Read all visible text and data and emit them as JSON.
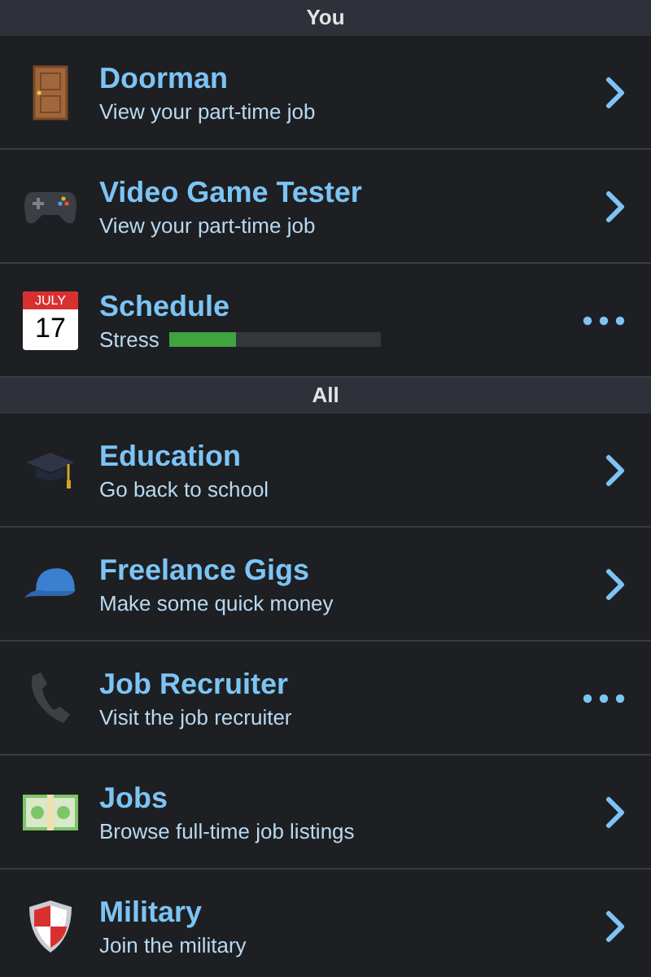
{
  "sections": [
    {
      "title": "You",
      "items": [
        {
          "title": "Doorman",
          "subtitle": "View your part-time job",
          "action": {
            "kind": "chevron"
          }
        },
        {
          "title": "Video Game Tester",
          "subtitle": "View your part-time job",
          "action": {
            "kind": "chevron"
          }
        },
        {
          "title": "Schedule",
          "calendar": {
            "month": "JULY",
            "day": "17"
          },
          "meter": {
            "label": "Stress",
            "level": 0.32
          },
          "action": {
            "kind": "more"
          }
        }
      ]
    },
    {
      "title": "All",
      "items": [
        {
          "title": "Education",
          "subtitle": "Go back to school",
          "action": {
            "kind": "chevron"
          }
        },
        {
          "title": "Freelance Gigs",
          "subtitle": "Make some quick money",
          "action": {
            "kind": "chevron"
          }
        },
        {
          "title": "Job Recruiter",
          "subtitle": "Visit the job recruiter",
          "action": {
            "kind": "more"
          }
        },
        {
          "title": "Jobs",
          "subtitle": "Browse full-time job listings",
          "action": {
            "kind": "chevron"
          }
        },
        {
          "title": "Military",
          "subtitle": "Join the military",
          "action": {
            "kind": "chevron"
          }
        }
      ]
    }
  ]
}
